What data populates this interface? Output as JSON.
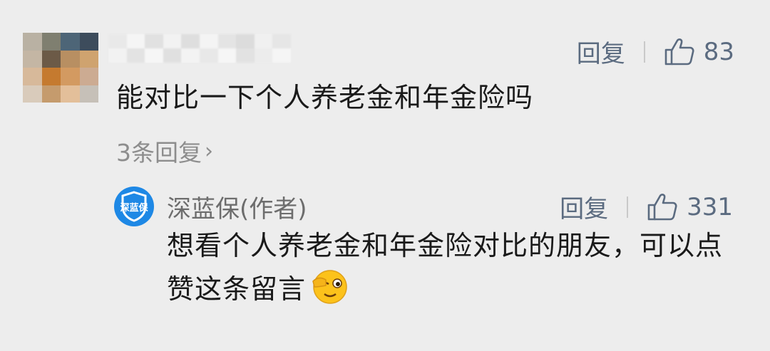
{
  "comment": {
    "text": "能对比一下个人养老金和年金险吗",
    "reply_label": "回复",
    "like_count": "83",
    "thread_link": "3条回复",
    "thread_chevron": "›"
  },
  "reply": {
    "author": "深蓝保(作者)",
    "badge_text": "深蓝保",
    "text": "想看个人养老金和年金险对比的朋友，可以点赞这条留言",
    "reply_label": "回复",
    "like_count": "331",
    "emoji": "wink-emoji"
  },
  "colors": {
    "background": "#ededed",
    "link": "#5b6b80",
    "badge": "#1e88e5",
    "muted": "#8d8d8d"
  }
}
